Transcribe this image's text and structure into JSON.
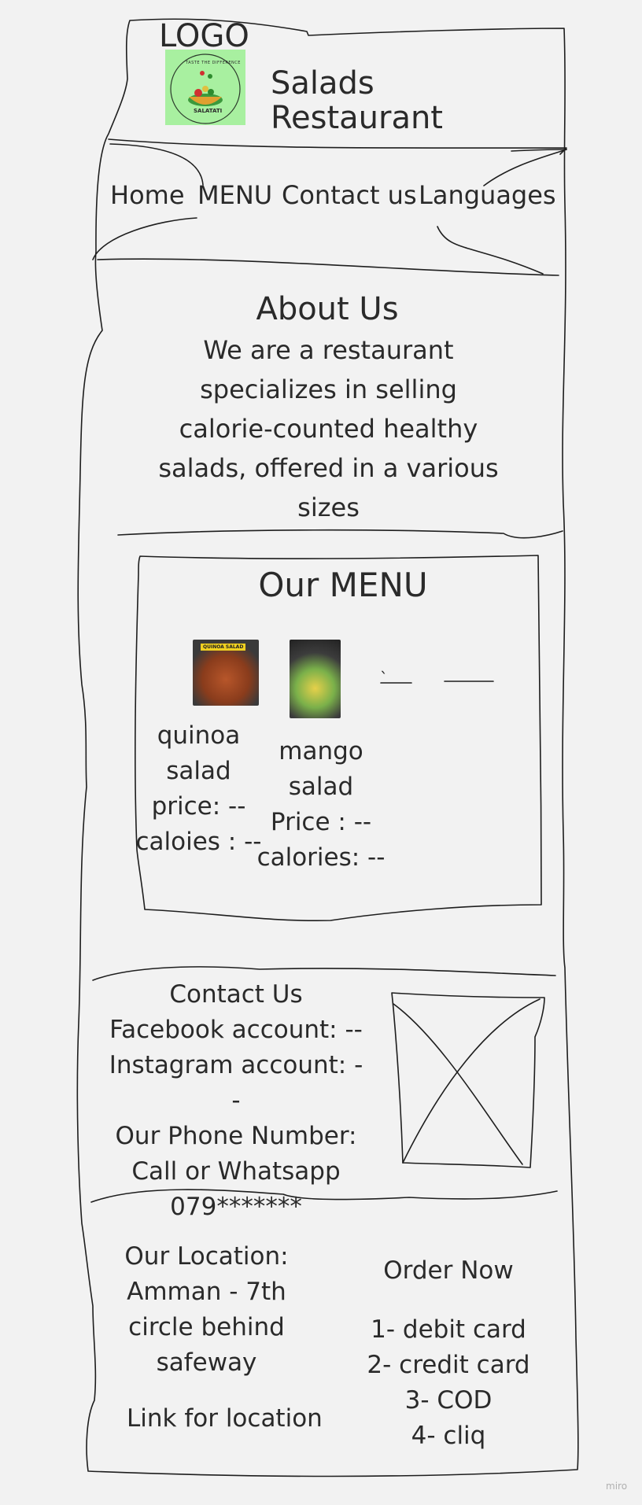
{
  "header": {
    "logo_label": "LOGO",
    "logo_badge_top": "TASTE THE DIFFERENCE",
    "logo_badge_bottom": "SALATATI",
    "title": "Salads Restaurant"
  },
  "nav": {
    "items": [
      "Home",
      "MENU",
      "Contact us",
      "Languages"
    ]
  },
  "about": {
    "heading": "About Us",
    "lines": [
      "We are a restaurant",
      "specializes in selling",
      "calorie-counted healthy",
      "salads, offered in a various",
      "sizes"
    ]
  },
  "menu": {
    "heading": "Our MENU",
    "items": [
      {
        "badge": "QUINOA SALAD",
        "lines": [
          "quinoa",
          "salad",
          "price: --",
          "caloies : --"
        ]
      },
      {
        "lines": [
          "mango",
          "salad",
          "Price : --",
          "calories: --"
        ]
      }
    ],
    "placeholder_mark": "`"
  },
  "contact": {
    "lines": [
      "Contact Us",
      "Facebook account: --",
      "Instagram account: --",
      "Our Phone Number:",
      "Call or Whatsapp",
      "079*******"
    ]
  },
  "location": {
    "lines": [
      "Our Location:",
      "Amman - 7th",
      "circle behind",
      "safeway"
    ],
    "link": "Link for location"
  },
  "order": {
    "heading": "Order Now",
    "options": [
      "1- debit card",
      "2- credit card",
      "3- COD",
      "4- cliq"
    ]
  },
  "watermark": "miro",
  "colors": {
    "logo_bg": "#a8f0a0",
    "ink": "#2a2a2a",
    "background": "#f2f2f2"
  }
}
